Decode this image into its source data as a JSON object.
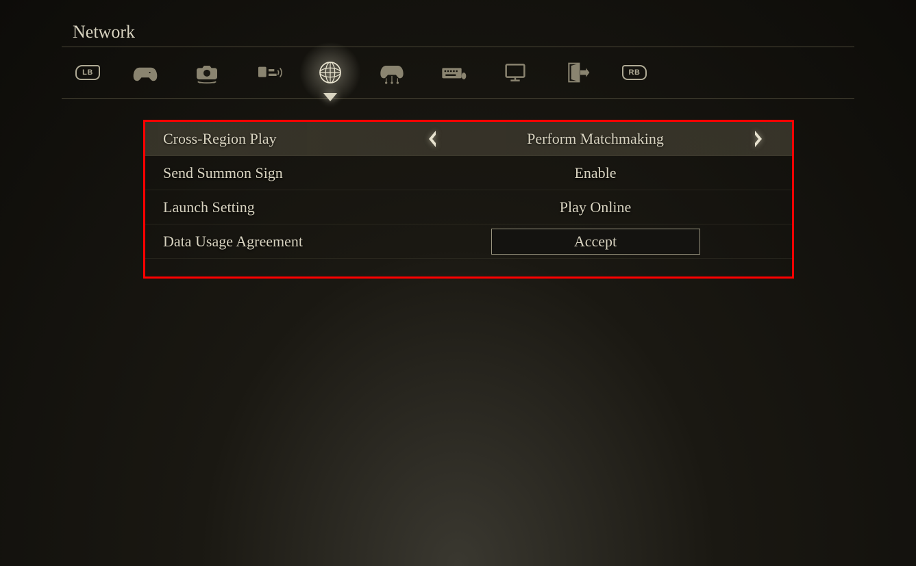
{
  "header": {
    "page_title": "Network",
    "bumper_left": "LB",
    "bumper_right": "RB"
  },
  "tabs": [
    {
      "name": "controller",
      "active": false
    },
    {
      "name": "camera",
      "active": false
    },
    {
      "name": "sound",
      "active": false
    },
    {
      "name": "network",
      "active": true
    },
    {
      "name": "controls-layout",
      "active": false
    },
    {
      "name": "keyboard",
      "active": false
    },
    {
      "name": "display",
      "active": false
    },
    {
      "name": "quit",
      "active": false
    }
  ],
  "settings": {
    "rows": [
      {
        "label": "Cross-Region Play",
        "value": "Perform Matchmaking",
        "selected": true,
        "has_chevrons": true,
        "is_button": false
      },
      {
        "label": "Send Summon Sign",
        "value": "Enable",
        "selected": false,
        "has_chevrons": false,
        "is_button": false
      },
      {
        "label": "Launch Setting",
        "value": "Play Online",
        "selected": false,
        "has_chevrons": false,
        "is_button": false
      },
      {
        "label": "Data Usage Agreement",
        "value": "Accept",
        "selected": false,
        "has_chevrons": false,
        "is_button": true
      }
    ]
  },
  "colors": {
    "highlight_red": "#ff0000",
    "text_primary": "#d8d3c0",
    "icon_inactive": "#8a8470"
  }
}
